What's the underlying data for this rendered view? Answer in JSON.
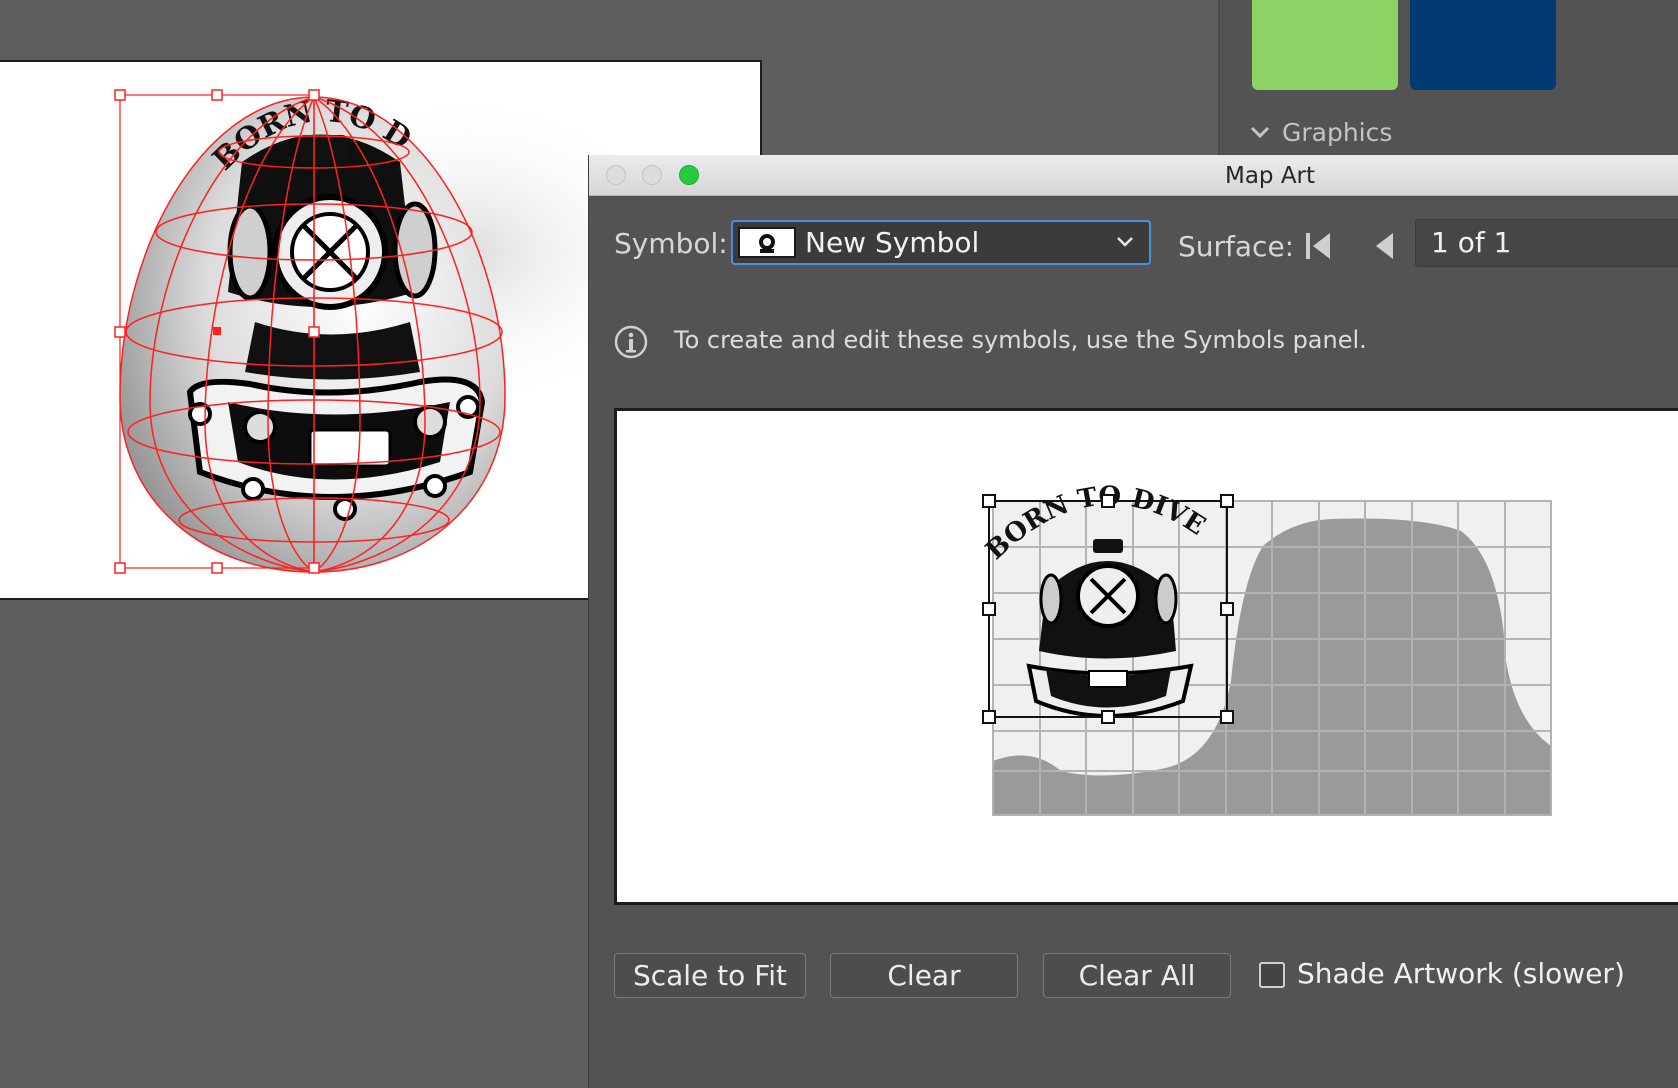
{
  "side_panel": {
    "graphics_header": "Graphics",
    "swatches": [
      "#8cd265",
      "#003b73"
    ]
  },
  "artboard": {
    "artwork_text": "BORN TO DIVE"
  },
  "dialog": {
    "title": "Map Art",
    "symbol_label": "Symbol:",
    "symbol_value": "New Symbol",
    "surface_label": "Surface:",
    "surface_page": "1 of 1",
    "info_text": "To create and edit these symbols, use the Symbols panel.",
    "preview_artwork_text": "BORN TO DIVE",
    "buttons": {
      "scale_to_fit": "Scale to Fit",
      "clear": "Clear",
      "clear_all": "Clear All"
    },
    "shade_artwork_label": "Shade Artwork (slower)",
    "shade_artwork_checked": false
  },
  "colors": {
    "selection_red": "#ff2020",
    "focus_blue": "#4a90e2",
    "zoom_green": "#27c93f"
  }
}
